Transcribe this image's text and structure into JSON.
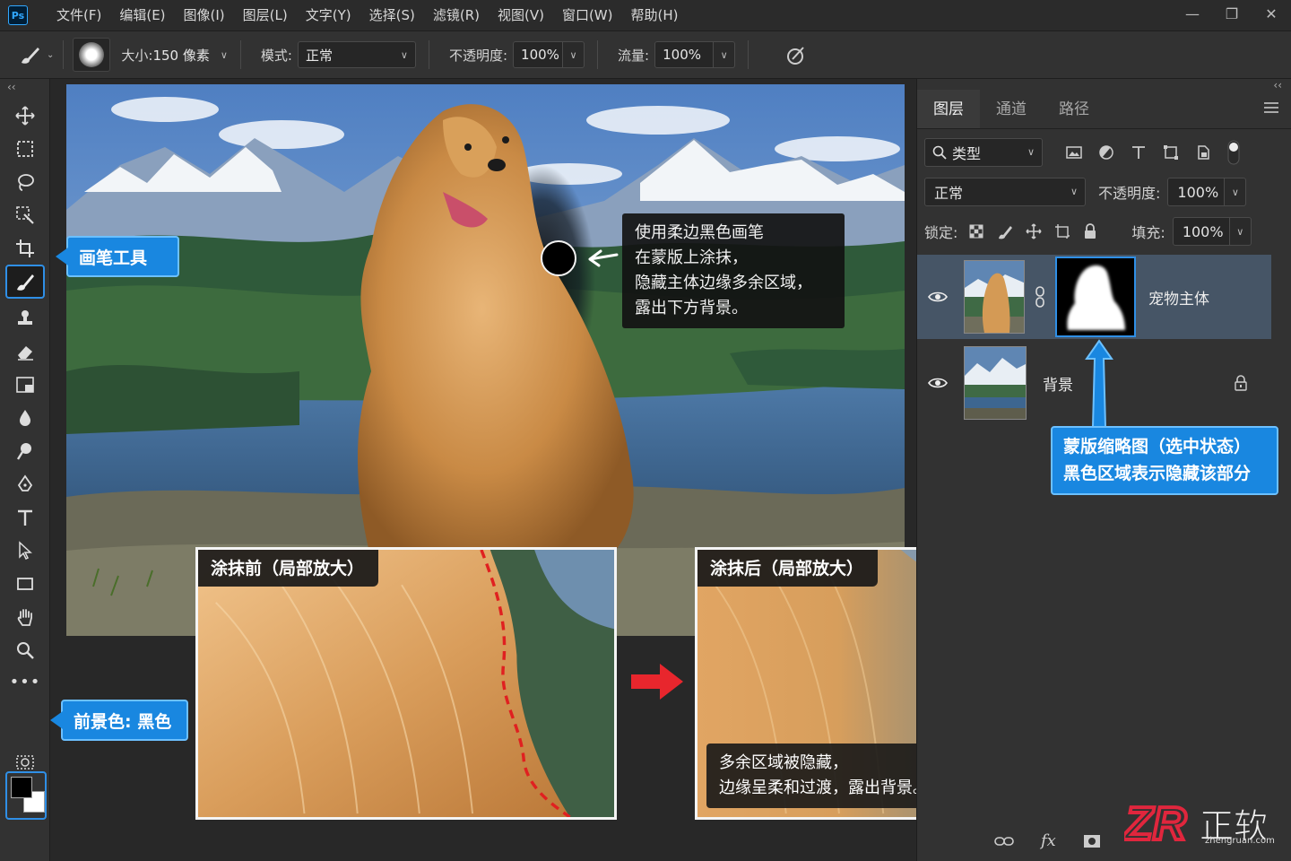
{
  "app": {
    "logo": "Ps"
  },
  "menu": [
    "文件(F)",
    "编辑(E)",
    "图像(I)",
    "图层(L)",
    "文字(Y)",
    "选择(S)",
    "滤镜(R)",
    "视图(V)",
    "窗口(W)",
    "帮助(H)"
  ],
  "window_controls": {
    "minimize": "—",
    "restore": "❐",
    "close": "✕"
  },
  "options_bar": {
    "size_label": "大小:",
    "size_value": "150 像素",
    "mode_label": "模式:",
    "mode_value": "正常",
    "opacity_label": "不透明度:",
    "opacity_value": "100%",
    "flow_label": "流量:",
    "flow_value": "100%"
  },
  "toolbar": {
    "collapse": "‹‹",
    "brush_callout": "画笔工具",
    "foreground_callout": "前景色: 黑色",
    "foreground_color": "#000000",
    "background_color": "#ffffff"
  },
  "canvas": {
    "note_lines": [
      "使用柔边黑色画笔",
      "在蒙版上涂抹，",
      "隐藏主体边缘多余区域，",
      "露出下方背景。"
    ]
  },
  "zoom_before": {
    "title": "涂抹前（局部放大）"
  },
  "zoom_after": {
    "title": "涂抹后（局部放大）",
    "caption_lines": [
      "多余区域被隐藏，",
      "边缘呈柔和过渡，露出背景。"
    ]
  },
  "layers_panel": {
    "collapse": "‹‹",
    "tabs": [
      "图层",
      "通道",
      "路径"
    ],
    "filter_label": "类型",
    "blend_mode": "正常",
    "opacity_label": "不透明度:",
    "opacity_value": "100%",
    "lock_label": "锁定:",
    "fill_label": "填充:",
    "fill_value": "100%",
    "layers": [
      {
        "name": "宠物主体",
        "selected": true,
        "has_mask": true
      },
      {
        "name": "背景",
        "selected": false,
        "locked": true
      }
    ],
    "bottom_icons": [
      "link-icon",
      "fx-icon",
      "mask-icon"
    ],
    "fx_label": "fx"
  },
  "mask_callout_lines": [
    "蒙版缩略图（选中状态）",
    "黑色区域表示隐藏该部分"
  ],
  "watermark": {
    "brand": "正软",
    "url": "zhengruan.com",
    "logo": "ZR"
  },
  "colors": {
    "accent": "#1987e0",
    "panel": "#323232",
    "selected_layer": "#465566",
    "arrow_red": "#e8262d"
  }
}
